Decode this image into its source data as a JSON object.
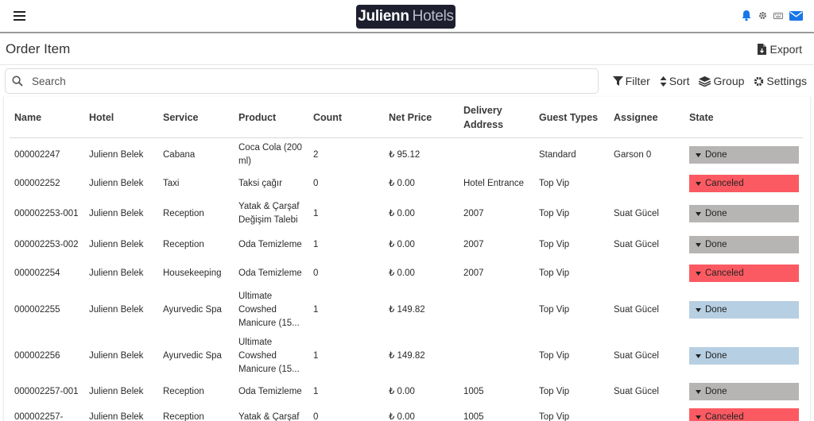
{
  "header": {
    "logo_bold": "Julienn",
    "logo_light": "Hotels"
  },
  "page": {
    "title": "Order Item",
    "export_label": "Export"
  },
  "search": {
    "placeholder": "Search"
  },
  "toolbar": {
    "filter": "Filter",
    "sort": "Sort",
    "group": "Group",
    "settings": "Settings"
  },
  "table": {
    "columns": [
      "Name",
      "Hotel",
      "Service",
      "Product",
      "Count",
      "Net Price",
      "Delivery Address",
      "Guest Types",
      "Assignee",
      "State"
    ],
    "rows": [
      {
        "name": "000002247",
        "hotel": "Julienn Belek",
        "service": "Cabana",
        "product": "Coca Cola (200 ml)",
        "count": "2",
        "price": "₺ 95.12",
        "address": "",
        "guest": "Standard",
        "assignee": "Garson 0",
        "state": "Done",
        "state_type": "done"
      },
      {
        "name": "000002252",
        "hotel": "Julienn Belek",
        "service": "Taxi",
        "product": "Taksi çağır",
        "count": "0",
        "price": "₺ 0.00",
        "address": "Hotel Entrance",
        "guest": "Top Vip",
        "assignee": "",
        "state": "Canceled",
        "state_type": "canceled"
      },
      {
        "name": "000002253-001",
        "hotel": "Julienn Belek",
        "service": "Reception",
        "product": "Yatak & Çarşaf Değişim Talebi",
        "count": "1",
        "price": "₺ 0.00",
        "address": "2007",
        "guest": "Top Vip",
        "assignee": "Suat Gücel",
        "state": "Done",
        "state_type": "done"
      },
      {
        "name": "000002253-002",
        "hotel": "Julienn Belek",
        "service": "Reception",
        "product": "Oda Temizleme",
        "count": "1",
        "price": "₺ 0.00",
        "address": "2007",
        "guest": "Top Vip",
        "assignee": "Suat Gücel",
        "state": "Done",
        "state_type": "done"
      },
      {
        "name": "000002254",
        "hotel": "Julienn Belek",
        "service": "Housekeeping",
        "product": "Oda Temizleme",
        "count": "0",
        "price": "₺ 0.00",
        "address": "2007",
        "guest": "Top Vip",
        "assignee": "",
        "state": "Canceled",
        "state_type": "canceled"
      },
      {
        "name": "000002255",
        "hotel": "Julienn Belek",
        "service": "Ayurvedic Spa",
        "product": "Ultimate Cowshed Manicure (15...",
        "count": "1",
        "price": "₺ 149.82",
        "address": "",
        "guest": "Top Vip",
        "assignee": "Suat Gücel",
        "state": "Done",
        "state_type": "done-blue"
      },
      {
        "name": "000002256",
        "hotel": "Julienn Belek",
        "service": "Ayurvedic Spa",
        "product": "Ultimate Cowshed Manicure (15...",
        "count": "1",
        "price": "₺ 149.82",
        "address": "",
        "guest": "Top Vip",
        "assignee": "Suat Gücel",
        "state": "Done",
        "state_type": "done-blue"
      },
      {
        "name": "000002257-001",
        "hotel": "Julienn Belek",
        "service": "Reception",
        "product": "Oda Temizleme",
        "count": "1",
        "price": "₺ 0.00",
        "address": "1005",
        "guest": "Top Vip",
        "assignee": "Suat Gücel",
        "state": "Done",
        "state_type": "done"
      },
      {
        "name": "000002257-",
        "hotel": "Julienn Belek",
        "service": "Reception",
        "product": "Yatak & Çarşaf",
        "count": "0",
        "price": "₺ 0.00",
        "address": "1005",
        "guest": "Top Vip",
        "assignee": "",
        "state": "Canceled",
        "state_type": "canceled"
      }
    ]
  },
  "icons": {
    "menu": "hamburger-icon",
    "bell": "bell-icon",
    "gear": "gear-icon",
    "keyboard": "keyboard-icon",
    "mail": "mail-icon"
  },
  "colors": {
    "state_done": "#b7b4b4",
    "state_canceled": "#fb5a62",
    "state_done_blue": "#b7cfe2",
    "accent_blue": "#1877e8",
    "logo_bg": "#1d1f2f"
  }
}
